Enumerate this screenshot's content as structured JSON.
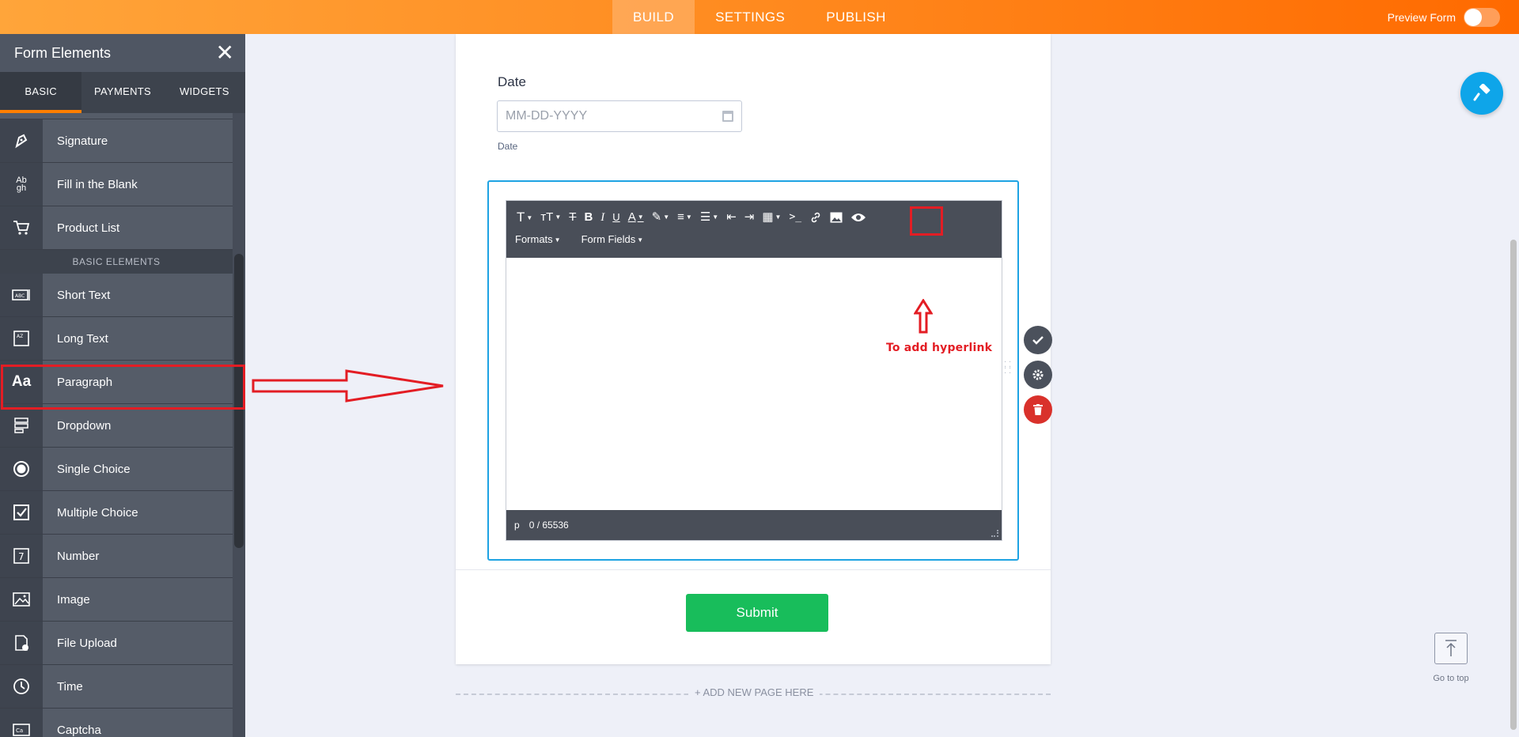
{
  "topbar": {
    "tabs": [
      {
        "label": "BUILD",
        "active": true
      },
      {
        "label": "SETTINGS",
        "active": false
      },
      {
        "label": "PUBLISH",
        "active": false
      }
    ],
    "preview_label": "Preview Form",
    "preview_on": false
  },
  "sidebar": {
    "title": "Form Elements",
    "tabs": [
      {
        "label": "BASIC",
        "active": true
      },
      {
        "label": "PAYMENTS",
        "active": false
      },
      {
        "label": "WIDGETS",
        "active": false
      }
    ],
    "items_top": [
      {
        "label": "Signature",
        "icon": "signature-icon",
        "glyph": "✒"
      },
      {
        "label": "Fill in the Blank",
        "icon": "fill-blank-icon",
        "glyph": "Ab"
      },
      {
        "label": "Product List",
        "icon": "cart-icon",
        "glyph": "🛒"
      }
    ],
    "section_label": "BASIC ELEMENTS",
    "items": [
      {
        "label": "Short Text",
        "icon": "short-text-icon",
        "glyph": "▭"
      },
      {
        "label": "Long Text",
        "icon": "long-text-icon",
        "glyph": "▢"
      },
      {
        "label": "Paragraph",
        "icon": "paragraph-icon",
        "glyph": "Aa"
      },
      {
        "label": "Dropdown",
        "icon": "dropdown-icon",
        "glyph": "☰"
      },
      {
        "label": "Single Choice",
        "icon": "radio-icon",
        "glyph": "◉"
      },
      {
        "label": "Multiple Choice",
        "icon": "checkbox-icon",
        "glyph": "☑"
      },
      {
        "label": "Number",
        "icon": "number-icon",
        "glyph": "7"
      },
      {
        "label": "Image",
        "icon": "image-icon",
        "glyph": "▨"
      },
      {
        "label": "File Upload",
        "icon": "file-upload-icon",
        "glyph": "⎙"
      },
      {
        "label": "Time",
        "icon": "clock-icon",
        "glyph": "◷"
      },
      {
        "label": "Captcha",
        "icon": "captcha-icon",
        "glyph": "⌨"
      }
    ]
  },
  "form": {
    "date": {
      "label": "Date",
      "placeholder": "MM-DD-YYYY",
      "sublabel": "Date"
    },
    "editor": {
      "toolbar_row2": [
        {
          "label": "Formats"
        },
        {
          "label": "Form Fields"
        }
      ],
      "status_tag": "p",
      "status_count": "0 / 65536"
    },
    "submit_label": "Submit",
    "add_page_label": "+ ADD NEW PAGE HERE"
  },
  "annotation": {
    "hyperlink_text": "To add hyperlink",
    "color": "#e31d24"
  },
  "right": {
    "go_top_label": "Go to top"
  },
  "colors": {
    "accent": "#ff8a1f",
    "selection": "#1ea3e3",
    "submit": "#18bd5b",
    "delete": "#d9312b"
  }
}
